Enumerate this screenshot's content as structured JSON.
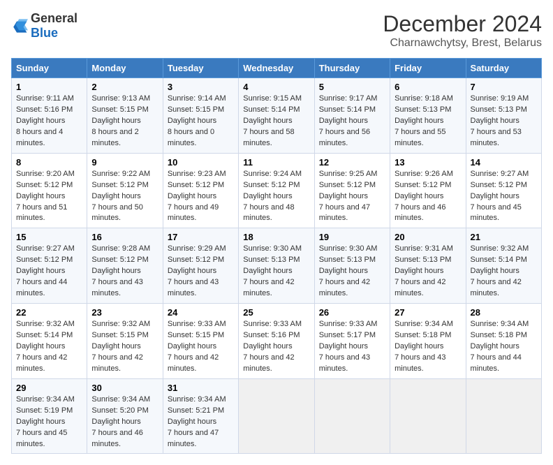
{
  "logo": {
    "general": "General",
    "blue": "Blue"
  },
  "title": "December 2024",
  "subtitle": "Charnawchytsy, Brest, Belarus",
  "days_of_week": [
    "Sunday",
    "Monday",
    "Tuesday",
    "Wednesday",
    "Thursday",
    "Friday",
    "Saturday"
  ],
  "weeks": [
    [
      {
        "day": "1",
        "sunrise": "9:11 AM",
        "sunset": "5:16 PM",
        "daylight": "8 hours and 4 minutes."
      },
      {
        "day": "2",
        "sunrise": "9:13 AM",
        "sunset": "5:15 PM",
        "daylight": "8 hours and 2 minutes."
      },
      {
        "day": "3",
        "sunrise": "9:14 AM",
        "sunset": "5:15 PM",
        "daylight": "8 hours and 0 minutes."
      },
      {
        "day": "4",
        "sunrise": "9:15 AM",
        "sunset": "5:14 PM",
        "daylight": "7 hours and 58 minutes."
      },
      {
        "day": "5",
        "sunrise": "9:17 AM",
        "sunset": "5:14 PM",
        "daylight": "7 hours and 56 minutes."
      },
      {
        "day": "6",
        "sunrise": "9:18 AM",
        "sunset": "5:13 PM",
        "daylight": "7 hours and 55 minutes."
      },
      {
        "day": "7",
        "sunrise": "9:19 AM",
        "sunset": "5:13 PM",
        "daylight": "7 hours and 53 minutes."
      }
    ],
    [
      {
        "day": "8",
        "sunrise": "9:20 AM",
        "sunset": "5:12 PM",
        "daylight": "7 hours and 51 minutes."
      },
      {
        "day": "9",
        "sunrise": "9:22 AM",
        "sunset": "5:12 PM",
        "daylight": "7 hours and 50 minutes."
      },
      {
        "day": "10",
        "sunrise": "9:23 AM",
        "sunset": "5:12 PM",
        "daylight": "7 hours and 49 minutes."
      },
      {
        "day": "11",
        "sunrise": "9:24 AM",
        "sunset": "5:12 PM",
        "daylight": "7 hours and 48 minutes."
      },
      {
        "day": "12",
        "sunrise": "9:25 AM",
        "sunset": "5:12 PM",
        "daylight": "7 hours and 47 minutes."
      },
      {
        "day": "13",
        "sunrise": "9:26 AM",
        "sunset": "5:12 PM",
        "daylight": "7 hours and 46 minutes."
      },
      {
        "day": "14",
        "sunrise": "9:27 AM",
        "sunset": "5:12 PM",
        "daylight": "7 hours and 45 minutes."
      }
    ],
    [
      {
        "day": "15",
        "sunrise": "9:27 AM",
        "sunset": "5:12 PM",
        "daylight": "7 hours and 44 minutes."
      },
      {
        "day": "16",
        "sunrise": "9:28 AM",
        "sunset": "5:12 PM",
        "daylight": "7 hours and 43 minutes."
      },
      {
        "day": "17",
        "sunrise": "9:29 AM",
        "sunset": "5:12 PM",
        "daylight": "7 hours and 43 minutes."
      },
      {
        "day": "18",
        "sunrise": "9:30 AM",
        "sunset": "5:13 PM",
        "daylight": "7 hours and 42 minutes."
      },
      {
        "day": "19",
        "sunrise": "9:30 AM",
        "sunset": "5:13 PM",
        "daylight": "7 hours and 42 minutes."
      },
      {
        "day": "20",
        "sunrise": "9:31 AM",
        "sunset": "5:13 PM",
        "daylight": "7 hours and 42 minutes."
      },
      {
        "day": "21",
        "sunrise": "9:32 AM",
        "sunset": "5:14 PM",
        "daylight": "7 hours and 42 minutes."
      }
    ],
    [
      {
        "day": "22",
        "sunrise": "9:32 AM",
        "sunset": "5:14 PM",
        "daylight": "7 hours and 42 minutes."
      },
      {
        "day": "23",
        "sunrise": "9:32 AM",
        "sunset": "5:15 PM",
        "daylight": "7 hours and 42 minutes."
      },
      {
        "day": "24",
        "sunrise": "9:33 AM",
        "sunset": "5:15 PM",
        "daylight": "7 hours and 42 minutes."
      },
      {
        "day": "25",
        "sunrise": "9:33 AM",
        "sunset": "5:16 PM",
        "daylight": "7 hours and 42 minutes."
      },
      {
        "day": "26",
        "sunrise": "9:33 AM",
        "sunset": "5:17 PM",
        "daylight": "7 hours and 43 minutes."
      },
      {
        "day": "27",
        "sunrise": "9:34 AM",
        "sunset": "5:18 PM",
        "daylight": "7 hours and 43 minutes."
      },
      {
        "day": "28",
        "sunrise": "9:34 AM",
        "sunset": "5:18 PM",
        "daylight": "7 hours and 44 minutes."
      }
    ],
    [
      {
        "day": "29",
        "sunrise": "9:34 AM",
        "sunset": "5:19 PM",
        "daylight": "7 hours and 45 minutes."
      },
      {
        "day": "30",
        "sunrise": "9:34 AM",
        "sunset": "5:20 PM",
        "daylight": "7 hours and 46 minutes."
      },
      {
        "day": "31",
        "sunrise": "9:34 AM",
        "sunset": "5:21 PM",
        "daylight": "7 hours and 47 minutes."
      },
      null,
      null,
      null,
      null
    ]
  ]
}
